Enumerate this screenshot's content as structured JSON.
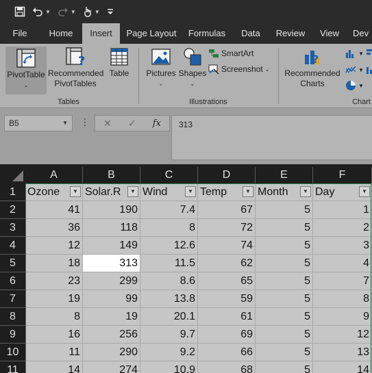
{
  "qat": {
    "save_icon": "save-icon",
    "undo_icon": "undo-icon",
    "redo_icon": "redo-icon",
    "touch_icon": "touch-mode-icon",
    "customize_icon": "customize-qat-icon"
  },
  "tabs": [
    "File",
    "Home",
    "Insert",
    "Page Layout",
    "Formulas",
    "Data",
    "Review",
    "View",
    "Dev"
  ],
  "active_tab": "Insert",
  "ribbon": {
    "tables": {
      "label": "Tables",
      "pivottable": "PivotTable",
      "recommended_line1": "Recommended",
      "recommended_line2": "PivotTables",
      "table": "Table"
    },
    "illustrations": {
      "label": "Illustrations",
      "pictures": "Pictures",
      "shapes": "Shapes",
      "smartart": "SmartArt",
      "screenshot": "Screenshot"
    },
    "charts": {
      "label": "Chart",
      "recommended_line1": "Recommended",
      "recommended_line2": "Charts"
    }
  },
  "formula_bar": {
    "name_box": "B5",
    "formula": "313",
    "fx": "fx"
  },
  "grid": {
    "columns": [
      "A",
      "B",
      "C",
      "D",
      "E",
      "F"
    ],
    "rows": [
      "1",
      "2",
      "3",
      "4",
      "5",
      "6",
      "7",
      "8",
      "9",
      "10",
      "11"
    ],
    "headers": [
      "Ozone",
      "Solar.R",
      "Wind",
      "Temp",
      "Month",
      "Day"
    ],
    "data": [
      [
        "41",
        "190",
        "7.4",
        "67",
        "5",
        "1"
      ],
      [
        "36",
        "118",
        "8",
        "72",
        "5",
        "2"
      ],
      [
        "12",
        "149",
        "12.6",
        "74",
        "5",
        "3"
      ],
      [
        "18",
        "313",
        "11.5",
        "62",
        "5",
        "4"
      ],
      [
        "23",
        "299",
        "8.6",
        "65",
        "5",
        "7"
      ],
      [
        "19",
        "99",
        "13.8",
        "59",
        "5",
        "8"
      ],
      [
        "8",
        "19",
        "20.1",
        "61",
        "5",
        "9"
      ],
      [
        "16",
        "256",
        "9.7",
        "69",
        "5",
        "12"
      ],
      [
        "11",
        "290",
        "9.2",
        "66",
        "5",
        "13"
      ],
      [
        "14",
        "274",
        "10.9",
        "68",
        "5",
        "14"
      ]
    ],
    "selected_cell": "B5"
  },
  "colors": {
    "accent_table_border": "#2a7a4b",
    "ribbon_bg": "#b1b1b1",
    "dark_bg": "#2b2b2b"
  }
}
